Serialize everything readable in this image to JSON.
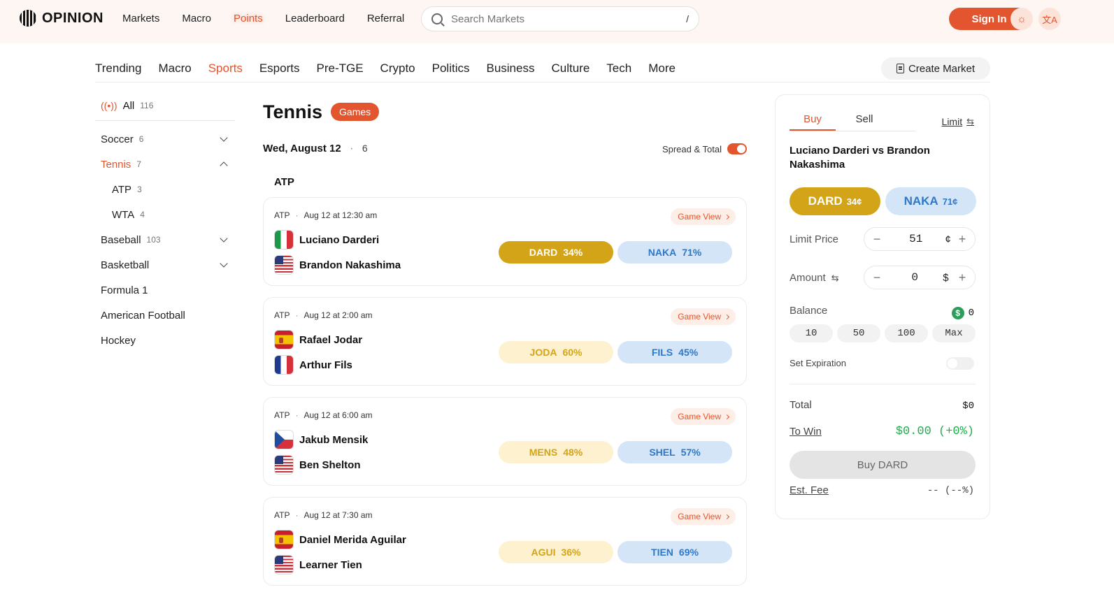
{
  "header": {
    "logo": "OPINION",
    "nav": [
      "Markets",
      "Macro",
      "Points",
      "Leaderboard",
      "Referral"
    ],
    "search_placeholder": "Search Markets",
    "search_shortcut": "/",
    "signin": "Sign In",
    "theme_icon": "sun-icon",
    "lang_icon": "translate-icon"
  },
  "categories": [
    "Trending",
    "Macro",
    "Sports",
    "Esports",
    "Pre-TGE",
    "Crypto",
    "Politics",
    "Business",
    "Culture",
    "Tech",
    "More"
  ],
  "active_category": "Sports",
  "create_market": "Create Market",
  "sidebar": {
    "all": {
      "label": "All",
      "count": "116"
    },
    "items": [
      {
        "label": "Soccer",
        "count": "6",
        "chevron": "down"
      },
      {
        "label": "Tennis",
        "count": "7",
        "chevron": "up",
        "active": true
      },
      {
        "label": "ATP",
        "count": "3",
        "sub": true
      },
      {
        "label": "WTA",
        "count": "4",
        "sub": true
      },
      {
        "label": "Baseball",
        "count": "103",
        "chevron": "down"
      },
      {
        "label": "Basketball",
        "count": "",
        "chevron": "down"
      },
      {
        "label": "Formula 1",
        "count": ""
      },
      {
        "label": "American Football",
        "count": ""
      },
      {
        "label": "Hockey",
        "count": ""
      }
    ]
  },
  "main": {
    "title": "Tennis",
    "badge": "Games",
    "date": "Wed, August 12",
    "date_count": "6",
    "spread_total": "Spread & Total",
    "section": "ATP",
    "game_view": "Game View",
    "games": [
      {
        "league": "ATP",
        "time": "Aug 12 at 12:30 am",
        "team1": "Luciano Darderi",
        "flag1": "it",
        "team2": "Brandon Nakashima",
        "flag2": "us",
        "odd1_code": "DARD",
        "odd1_pct": "34%",
        "odd2_code": "NAKA",
        "odd2_pct": "71%",
        "selected": true
      },
      {
        "league": "ATP",
        "time": "Aug 12 at 2:00 am",
        "team1": "Rafael Jodar",
        "flag1": "es",
        "team2": "Arthur Fils",
        "flag2": "fr",
        "odd1_code": "JODA",
        "odd1_pct": "60%",
        "odd2_code": "FILS",
        "odd2_pct": "45%"
      },
      {
        "league": "ATP",
        "time": "Aug 12 at 6:00 am",
        "team1": "Jakub Mensik",
        "flag1": "cz",
        "team2": "Ben Shelton",
        "flag2": "us",
        "odd1_code": "MENS",
        "odd1_pct": "48%",
        "odd2_code": "SHEL",
        "odd2_pct": "57%"
      },
      {
        "league": "ATP",
        "time": "Aug 12 at 7:30 am",
        "team1": "Daniel Merida Aguilar",
        "flag1": "es",
        "team2": "Learner Tien",
        "flag2": "us",
        "odd1_code": "AGUI",
        "odd1_pct": "36%",
        "odd2_code": "TIEN",
        "odd2_pct": "69%"
      }
    ]
  },
  "panel": {
    "buy": "Buy",
    "sell": "Sell",
    "limit": "Limit",
    "match": "Luciano Darderi vs Brandon Nakashima",
    "opt1_code": "DARD",
    "opt1_price": "34¢",
    "opt2_code": "NAKA",
    "opt2_price": "71¢",
    "limit_price_label": "Limit Price",
    "limit_price": "51",
    "limit_unit": "¢",
    "amount_label": "Amount",
    "amount": "0",
    "amount_unit": "$",
    "balance_label": "Balance",
    "balance": "0",
    "quick": [
      "10",
      "50",
      "100",
      "Max"
    ],
    "expiration_label": "Set Expiration",
    "total_label": "Total",
    "total": "$0",
    "towin_label": "To Win",
    "towin": "$0.00 (+0%)",
    "buy_button": "Buy DARD",
    "fee_label": "Est. Fee",
    "fee": "-- (--%)"
  },
  "colors": {
    "accent": "#e2552f",
    "gold": "#d4a418",
    "blue": "#2e78c6",
    "green": "#1fae4b"
  }
}
